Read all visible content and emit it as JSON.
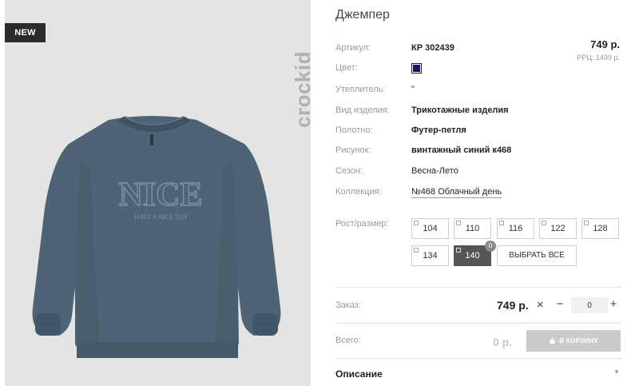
{
  "photo": {
    "badge": "NEW",
    "brand": "crockid",
    "print_title": "NICE",
    "print_subtitle": "HAVE A NICE DAY"
  },
  "product": {
    "title": "Джемпер",
    "price": "749 р.",
    "rrp": "РРЦ: 1499 р."
  },
  "attributes": [
    {
      "label": "Артикул:",
      "value": "КР 302439"
    },
    {
      "label": "Цвет:",
      "value": "",
      "swatch_color": "#1b1570"
    },
    {
      "label": "Утеплитель:",
      "value": "\""
    },
    {
      "label": "Вид изделия:",
      "value": "Трикотажные изделия"
    },
    {
      "label": "Полотно:",
      "value": "Футер-петля"
    },
    {
      "label": "Рисунок:",
      "value": "винтажный синий к468"
    },
    {
      "label": "Сезон:",
      "value": "Весна-Лето"
    },
    {
      "label": "Коллекция:",
      "value": "№468 Облачный день"
    }
  ],
  "sizes": {
    "label": "Рост/размер:",
    "options": [
      "104",
      "110",
      "116",
      "122",
      "128",
      "134",
      "140"
    ],
    "selected": "140",
    "selected_count": "0",
    "select_all": "ВЫБРАТЬ ВСЕ"
  },
  "order": {
    "label": "Заказ:",
    "price": "749 р.",
    "times_icon": "×",
    "minus": "−",
    "quantity": "0",
    "plus": "+"
  },
  "total": {
    "label": "Всего:",
    "value": "0 р.",
    "cart_button": "В КОРЗИНУ",
    "cart_icon": "basket-icon"
  },
  "description": {
    "title": "Описание",
    "chevron_icon": "chevron-down-icon"
  },
  "colors": {
    "accent_dark": "#555555",
    "sweater": "#4e6476",
    "photo_bg": "#e4e4e2"
  }
}
